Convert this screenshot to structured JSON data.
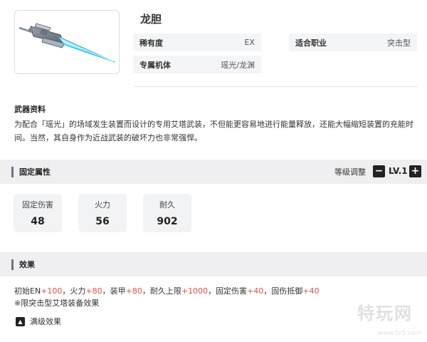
{
  "weapon": {
    "name": "龙胆",
    "info": {
      "rarity_key": "稀有度",
      "rarity_val": "EX",
      "class_key": "适合职业",
      "class_val": "突击型",
      "mecha_key": "专属机体",
      "mecha_val": "瑶光/龙渊"
    }
  },
  "material": {
    "label": "武器资料",
    "description": "为配合「瑶光」的场域发生装置而设计的专用艾塔武装，不但能更容易地进行能量释放，还能大幅缩短装置的充能时间。当然，其自身作为近战武装的破坏力也非常强悍。"
  },
  "fixed_attributes": {
    "title": "固定属性",
    "level_label": "等级调整",
    "level_value": "LV.1",
    "minus_icon": "minus-icon",
    "plus_icon": "plus-icon",
    "stats": [
      {
        "name": "固定伤害",
        "value": "48"
      },
      {
        "name": "火力",
        "value": "56"
      },
      {
        "name": "耐久",
        "value": "902"
      }
    ]
  },
  "effect": {
    "title": "效果",
    "items": [
      {
        "name": "初始EN",
        "sign": "+",
        "value": "100",
        "sep": "，"
      },
      {
        "name": "火力",
        "sign": "+",
        "value": "80",
        "sep": "，"
      },
      {
        "name": "装甲",
        "sign": "+",
        "value": "80",
        "sep": "，"
      },
      {
        "name": "耐久上限",
        "sign": "+",
        "value": "1000",
        "sep": "，"
      },
      {
        "name": "固定伤害",
        "sign": "+",
        "value": "40",
        "sep": "，"
      },
      {
        "name": "固伤抵御",
        "sign": "+",
        "value": "40",
        "sep": ""
      }
    ],
    "note": "※限突击型艾塔装备效果",
    "max_label": "满级效果",
    "max_icon": "arrow-up-icon"
  },
  "watermark": {
    "big": "特玩网",
    "small": "www.te5.com"
  },
  "colors": {
    "accent_bar": "#6b7385",
    "highlight": "#e05050",
    "weapon_glow": "#3fd0f0"
  }
}
